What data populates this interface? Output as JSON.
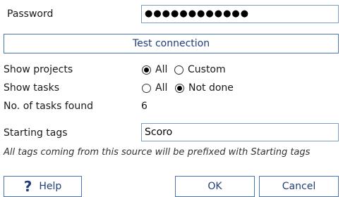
{
  "password": {
    "label": "Password",
    "value": "●●●●●●●●●●●●"
  },
  "test_connection": {
    "label": "Test connection"
  },
  "show_projects": {
    "label": "Show projects",
    "options": [
      "All",
      "Custom"
    ],
    "selected": "All"
  },
  "show_tasks": {
    "label": "Show tasks",
    "options": [
      "All",
      "Not done"
    ],
    "selected": "Not done"
  },
  "tasks_found": {
    "label": "No. of tasks found",
    "value": "6"
  },
  "starting_tags": {
    "label": "Starting tags",
    "value": "Scoro",
    "note": "All tags coming from this source will be prefixed with Starting tags"
  },
  "footer": {
    "help_label": "Help",
    "help_icon": "?",
    "ok_label": "OK",
    "cancel_label": "Cancel"
  },
  "colors": {
    "accent": "#4a74b4",
    "field_border": "#7a9cc6"
  }
}
